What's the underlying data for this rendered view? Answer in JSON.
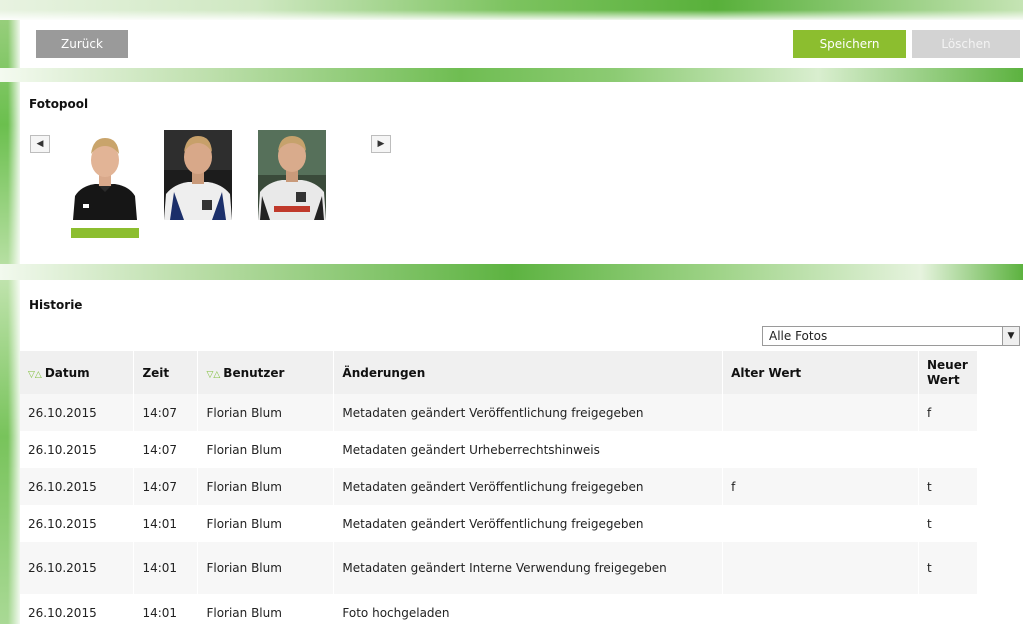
{
  "toolbar": {
    "back_label": "Zurück",
    "save_label": "Speichern",
    "delete_label": "Löschen"
  },
  "photos": {
    "title": "Fotopool",
    "prev_icon": "◀",
    "next_icon": "▶",
    "selected_index": 0
  },
  "history": {
    "title": "Historie",
    "filter": {
      "selected": "Alle Fotos",
      "dropdown_icon": "▼"
    },
    "sort_icon": "▽△",
    "columns": {
      "date": "Datum",
      "time": "Zeit",
      "user": "Benutzer",
      "changes": "Änderungen",
      "old_value": "Alter Wert",
      "new_value": "Neuer Wert"
    },
    "rows": [
      {
        "date": "26.10.2015",
        "time": "14:07",
        "user": "Florian Blum",
        "changes": "Metadaten geändert Veröffentlichung freigegeben",
        "old": "",
        "new": "f"
      },
      {
        "date": "26.10.2015",
        "time": "14:07",
        "user": "Florian Blum",
        "changes": "Metadaten geändert Urheberrechtshinweis",
        "old": "",
        "new": ""
      },
      {
        "date": "26.10.2015",
        "time": "14:07",
        "user": "Florian Blum",
        "changes": "Metadaten geändert Veröffentlichung freigegeben",
        "old": "f",
        "new": "t"
      },
      {
        "date": "26.10.2015",
        "time": "14:01",
        "user": "Florian Blum",
        "changes": "Metadaten geändert Veröffentlichung freigegeben",
        "old": "",
        "new": "t"
      },
      {
        "date": "26.10.2015",
        "time": "14:01",
        "user": "Florian Blum",
        "changes": "Metadaten geändert Interne Verwendung freigegeben",
        "old": "",
        "new": "t"
      },
      {
        "date": "26.10.2015",
        "time": "14:01",
        "user": "Florian Blum",
        "changes": "Foto hochgeladen",
        "old": "",
        "new": ""
      }
    ]
  },
  "colors": {
    "accent_green": "#8cbe2f",
    "back_button": "#9a9a9a",
    "delete_button_disabled": "#d3d3d3"
  }
}
